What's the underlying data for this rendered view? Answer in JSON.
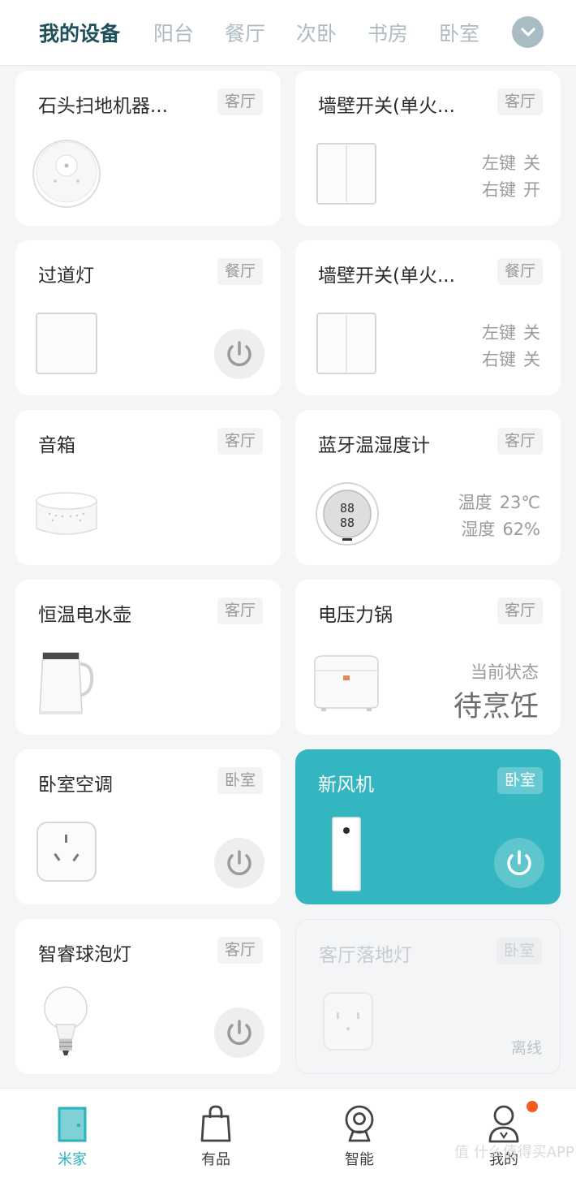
{
  "header": {
    "tabs": [
      {
        "label": "我的设备"
      },
      {
        "label": "阳台"
      },
      {
        "label": "餐厅"
      },
      {
        "label": "次卧"
      },
      {
        "label": "书房"
      },
      {
        "label": "卧室"
      }
    ],
    "expand_icon": "chevron-down-icon"
  },
  "devices": [
    {
      "name": "石头扫地机器...",
      "room": "客厅",
      "icon": "robot-vacuum"
    },
    {
      "name": "墙壁开关(单火...",
      "room": "客厅",
      "icon": "wall-switch-double",
      "status": [
        {
          "key": "左键",
          "value": "关"
        },
        {
          "key": "右键",
          "value": "开"
        }
      ]
    },
    {
      "name": "过道灯",
      "room": "餐厅",
      "icon": "wall-switch-single",
      "power": true
    },
    {
      "name": "墙壁开关(单火...",
      "room": "餐厅",
      "icon": "wall-switch-double",
      "status": [
        {
          "key": "左键",
          "value": "关"
        },
        {
          "key": "右键",
          "value": "关"
        }
      ]
    },
    {
      "name": "音箱",
      "room": "客厅",
      "icon": "speaker"
    },
    {
      "name": "蓝牙温湿度计",
      "room": "客厅",
      "icon": "thermometer",
      "status": [
        {
          "key": "温度",
          "value": "23℃"
        },
        {
          "key": "湿度",
          "value": "62%"
        }
      ]
    },
    {
      "name": "恒温电水壶",
      "room": "客厅",
      "icon": "kettle"
    },
    {
      "name": "电压力锅",
      "room": "客厅",
      "icon": "pressure-cooker",
      "state_label": "当前状态",
      "state_value": "待烹饪"
    },
    {
      "name": "卧室空调",
      "room": "卧室",
      "icon": "smart-plug",
      "power": true
    },
    {
      "name": "新风机",
      "room": "卧室",
      "icon": "air-purifier",
      "power": true,
      "active": true
    },
    {
      "name": "智睿球泡灯",
      "room": "客厅",
      "icon": "bulb",
      "power": true
    },
    {
      "name": "客厅落地灯",
      "room": "卧室",
      "icon": "smart-plug",
      "offline": true,
      "offline_label": "离线"
    }
  ],
  "nav": [
    {
      "label": "米家",
      "icon": "door-icon",
      "active": true
    },
    {
      "label": "有品",
      "icon": "shopping-bag-icon"
    },
    {
      "label": "智能",
      "icon": "camera-icon"
    },
    {
      "label": "我的",
      "icon": "user-icon",
      "badge": true
    }
  ],
  "colors": {
    "accent": "#33b6c0",
    "badge": "#f55a1e",
    "header_active": "#1f4f5a"
  },
  "watermark": "值 什么值得买APP"
}
